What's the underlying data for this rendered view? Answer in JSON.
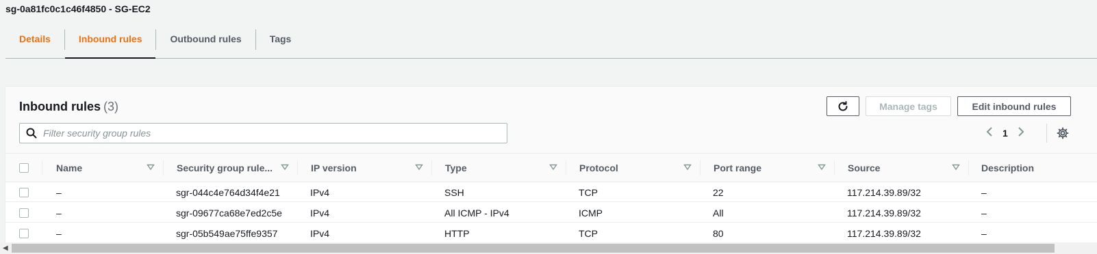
{
  "page": {
    "title": "sg-0a81fc0c1c46f4850 - SG-EC2"
  },
  "tabs": [
    {
      "label": "Details"
    },
    {
      "label": "Inbound rules"
    },
    {
      "label": "Outbound rules"
    },
    {
      "label": "Tags"
    }
  ],
  "panel": {
    "title": "Inbound rules",
    "count": "(3)",
    "manage_tags_label": "Manage tags",
    "edit_rules_label": "Edit inbound rules",
    "search_placeholder": "Filter security group rules",
    "current_page": "1"
  },
  "table": {
    "columns": [
      "Name",
      "Security group rule...",
      "IP version",
      "Type",
      "Protocol",
      "Port range",
      "Source",
      "Description"
    ],
    "rows": [
      {
        "name": "–",
        "rule_id": "sgr-044c4e764d34f4e21",
        "ip_version": "IPv4",
        "type": "SSH",
        "protocol": "TCP",
        "port_range": "22",
        "source": "117.214.39.89/32",
        "description": "–"
      },
      {
        "name": "–",
        "rule_id": "sgr-09677ca68e7ed2c5e",
        "ip_version": "IPv4",
        "type": "All ICMP - IPv4",
        "protocol": "ICMP",
        "port_range": "All",
        "source": "117.214.39.89/32",
        "description": "–"
      },
      {
        "name": "–",
        "rule_id": "sgr-05b549ae75ffe9357",
        "ip_version": "IPv4",
        "type": "HTTP",
        "protocol": "TCP",
        "port_range": "80",
        "source": "117.214.39.89/32",
        "description": "–"
      }
    ]
  },
  "colors": {
    "accent": "#ec7211",
    "text": "#16191f",
    "muted": "#545b64",
    "border": "#aab7b8"
  },
  "icons": [
    "refresh-icon",
    "search-icon",
    "chevron-left-icon",
    "chevron-right-icon",
    "settings-icon",
    "sort-icon"
  ]
}
